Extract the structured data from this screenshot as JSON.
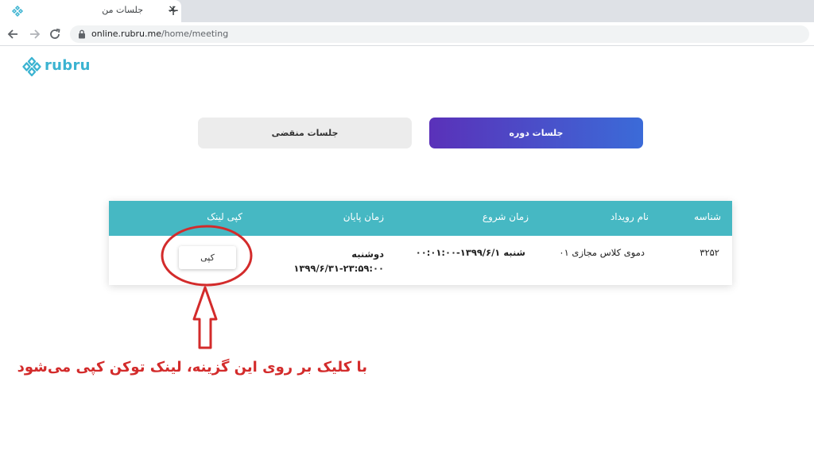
{
  "browser": {
    "tab_title": "جلسات من",
    "tab_close": "✕",
    "new_tab": "+",
    "url_host": "online.rubru.me",
    "url_path": "/home/meeting"
  },
  "brand": {
    "name": "rubru",
    "color": "#3bb3d1"
  },
  "segments": {
    "active_label": "جلسات دوره",
    "inactive_label": "جلسات منقضی"
  },
  "table": {
    "header_color": "#46b8c3",
    "columns": {
      "id": "شناسه",
      "event_name": "نام رویداد",
      "start_time": "زمان شروع",
      "end_time": "زمان پایان",
      "copy_link": "کپی لینک"
    },
    "rows": [
      {
        "id": "۳۲۵۲",
        "event_name": "دموی کلاس مجازی ۰۱",
        "start_time": "شنبه ۱۳۹۹/۶/۱-۰۰:۰۱:۰۰",
        "end_day": "دوشنبه",
        "end_time": "۱۳۹۹/۶/۳۱-۲۳:۵۹:۰۰",
        "copy_label": "کپی"
      }
    ]
  },
  "annotation": {
    "text": "با کلیک بر روی این گزینه، لینک توکن کپی می‌شود",
    "color": "#d32b2b"
  }
}
